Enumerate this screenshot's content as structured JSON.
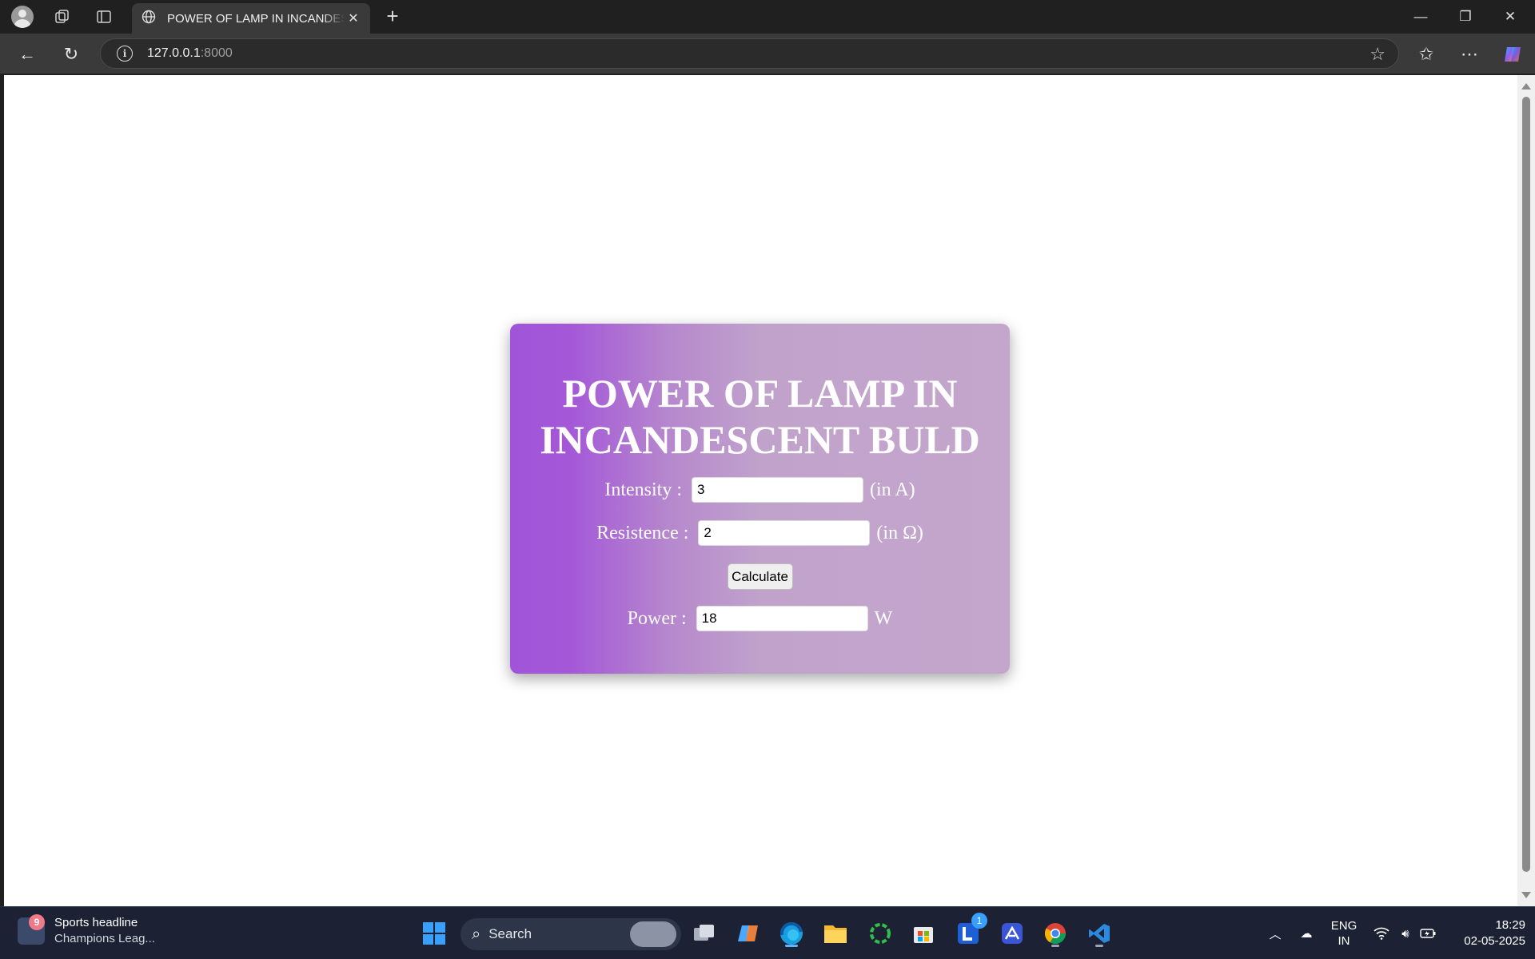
{
  "browser": {
    "tab_title": "POWER OF LAMP IN INCANDESCENT BULD",
    "url_host": "127.0.0.1",
    "url_port": ":8000"
  },
  "page": {
    "title": "POWER OF LAMP IN INCANDESCENT BULD",
    "intensity": {
      "label": "Intensity :",
      "value": "3",
      "unit": "(in A)"
    },
    "resistance": {
      "label": "Resistence :",
      "value": "2",
      "unit": "(in Ω)"
    },
    "calculate_label": "Calculate",
    "power": {
      "label": "Power :",
      "value": "18",
      "unit": "W"
    }
  },
  "taskbar": {
    "news_title": "Sports headline",
    "news_sub": "Champions Leag...",
    "news_badge": "9",
    "search_label": "Search",
    "app_badge": "1",
    "lang_top": "ENG",
    "lang_bottom": "IN",
    "time": "18:29",
    "date": "02-05-2025"
  },
  "colors": {
    "card_gradient_start": "#a055d9",
    "card_gradient_end": "#c4a6cc",
    "taskbar_bg": "#1c2233"
  }
}
